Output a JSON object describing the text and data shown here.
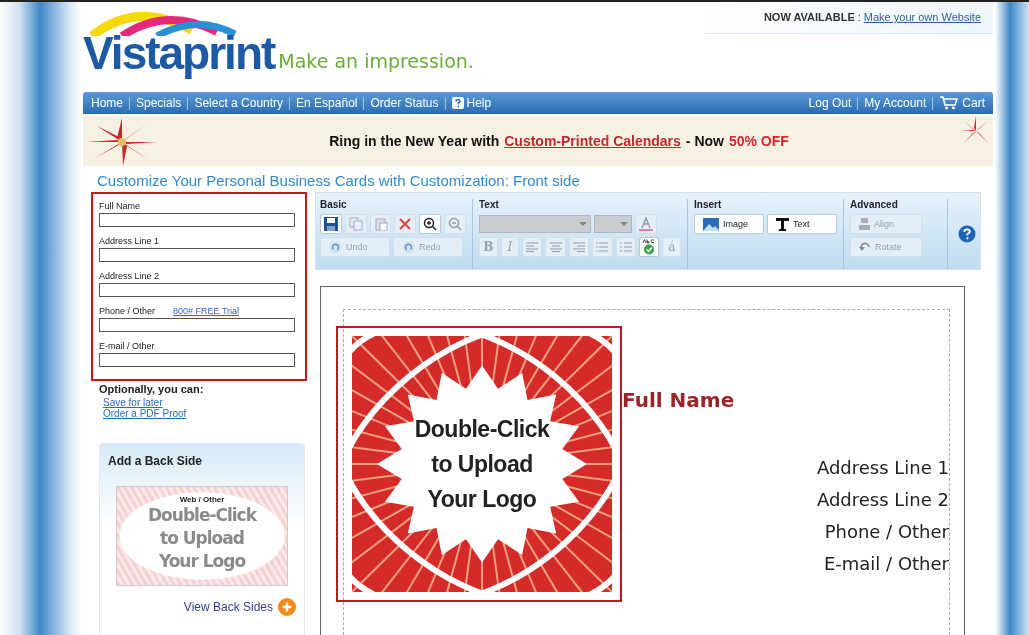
{
  "header": {
    "logo": "Vistaprint",
    "tagline": "Make an impression.",
    "notice_label": "NOW AVAILABLE",
    "notice_separator": ":",
    "notice_link": "Make your own Website"
  },
  "nav": {
    "left": [
      {
        "label": "Home"
      },
      {
        "label": "Specials"
      },
      {
        "label": "Select a Country"
      },
      {
        "label": "En Español"
      },
      {
        "label": "Order Status"
      },
      {
        "label": "Help",
        "kind": "help"
      }
    ],
    "right": [
      {
        "label": "Log Out"
      },
      {
        "label": "My Account"
      },
      {
        "label": "Cart",
        "kind": "cart"
      }
    ]
  },
  "banner": {
    "lead": "Ring in the New Year with",
    "link": "Custom-Printed Calendars",
    "middle": "- Now",
    "offer": "50% OFF"
  },
  "page_title": "Customize Your Personal Business Cards with Customization: Front side",
  "form": {
    "highlighted": true,
    "fields": [
      {
        "label": "Full Name"
      },
      {
        "label": "Address Line 1"
      },
      {
        "label": "Address Line 2"
      },
      {
        "label": "Phone / Other",
        "link": "800# FREE Trial"
      },
      {
        "label": "E-mail / Other"
      }
    ]
  },
  "optional": {
    "heading": "Optionally, you can:",
    "links": [
      "Save for later",
      "Order a PDF Proof"
    ]
  },
  "back_side": {
    "title": "Add a Back Side",
    "preview_label": "Web / Other",
    "preview_lines": [
      "Double-Click",
      "to Upload",
      "Your Logo"
    ],
    "link": "View Back Sides"
  },
  "toolbar": {
    "basic": {
      "title": "Basic",
      "buttons": [
        {
          "label": "Undo",
          "kind": "undo",
          "disabled": true
        },
        {
          "label": "Redo",
          "kind": "redo",
          "disabled": true
        }
      ]
    },
    "text": {
      "title": "Text",
      "format_buttons": [
        {
          "label": "B",
          "disabled": true
        },
        {
          "label": "I",
          "disabled": true
        }
      ],
      "accent": "á"
    },
    "insert": {
      "title": "Insert",
      "buttons": [
        {
          "label": "Image",
          "kind": "image",
          "disabled": false
        },
        {
          "label": "Text",
          "kind": "text",
          "disabled": false
        }
      ]
    },
    "advanced": {
      "title": "Advanced",
      "buttons": [
        {
          "label": "Align",
          "kind": "align",
          "disabled": true
        },
        {
          "label": "Rotate",
          "kind": "rotate",
          "disabled": true
        }
      ]
    }
  },
  "card": {
    "logo": {
      "selected": true,
      "lines": [
        "Double-Click",
        "to Upload",
        "Your Logo"
      ]
    },
    "name": "Full Name",
    "lines": [
      "Address Line 1",
      "Address Line 2",
      "Phone / Other",
      "E-mail / Other"
    ]
  }
}
